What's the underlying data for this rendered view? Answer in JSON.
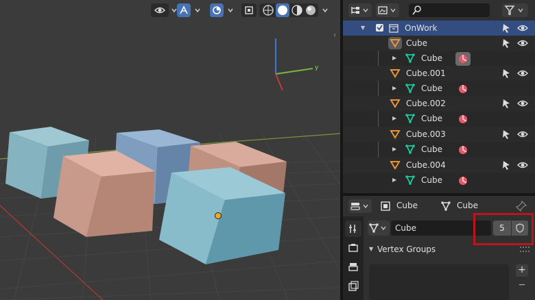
{
  "viewport": {
    "gizmo_labels": {
      "y": "y"
    }
  },
  "outliner": {
    "rows": [
      {
        "label": "OnWork"
      },
      {
        "label": "Cube"
      },
      {
        "label": "Cube"
      },
      {
        "label": "Cube.001"
      },
      {
        "label": "Cube"
      },
      {
        "label": "Cube.002"
      },
      {
        "label": "Cube"
      },
      {
        "label": "Cube.003"
      },
      {
        "label": "Cube"
      },
      {
        "label": "Cube.004"
      },
      {
        "label": "Cube"
      }
    ]
  },
  "properties": {
    "breadcrumb_object": "Cube",
    "breadcrumb_data": "Cube",
    "mesh_name": "Cube",
    "users_count": "5",
    "vertex_groups_label": "Vertex Groups",
    "add_label": "+",
    "remove_label": "−"
  },
  "colors": {
    "accent": "#4772b3",
    "selection": "#334d80",
    "mesh_icon": "#1fc9a0",
    "object_icon": "#e8953a",
    "material_icon": "#e45a68",
    "highlight": "#c0141b"
  }
}
